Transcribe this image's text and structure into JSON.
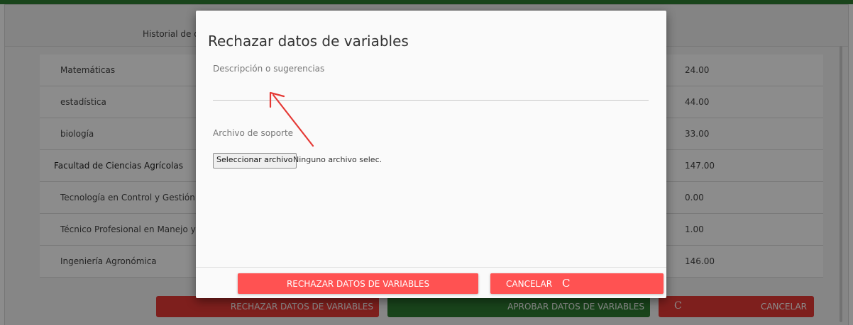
{
  "background": {
    "header_title": "Historial de d",
    "rows": [
      {
        "name": "Matemáticas",
        "value": "24.00"
      },
      {
        "name": "estadística",
        "value": "44.00"
      },
      {
        "name": "biología",
        "value": "33.00"
      },
      {
        "name": "Facultad de Ciencias Agrícolas",
        "value": "147.00"
      },
      {
        "name": "Tecnología en Control y Gestión de",
        "value": "0.00"
      },
      {
        "name": "Técnico Profesional en Manejo y Co",
        "value": "1.00"
      },
      {
        "name": "Ingeniería Agronómica",
        "value": "146.00"
      }
    ],
    "buttons": {
      "reject_label": "RECHAZAR DATOS DE VARIABLES",
      "approve_label": "APROBAR DATOS DE VARIABLES",
      "cancel_label": "CANCELAR",
      "cancel_icon_glyph": "C"
    }
  },
  "modal": {
    "title": "Rechazar datos de variables",
    "description_label": "Descripción o sugerencias",
    "description_value": "",
    "file_label": "Archivo de soporte",
    "file_button_label": "Seleccionar archivo",
    "file_status": "Ninguno archivo selec.",
    "reject_button_label": "RECHAZAR DATOS DE VARIABLES",
    "cancel_button_label": "CANCELAR",
    "cancel_icon_glyph": "C"
  },
  "colors": {
    "accent_red": "#ff5252",
    "reject_red": "#e53935",
    "approve_green": "#2e7d32",
    "annotation_arrow": "#e53935"
  }
}
